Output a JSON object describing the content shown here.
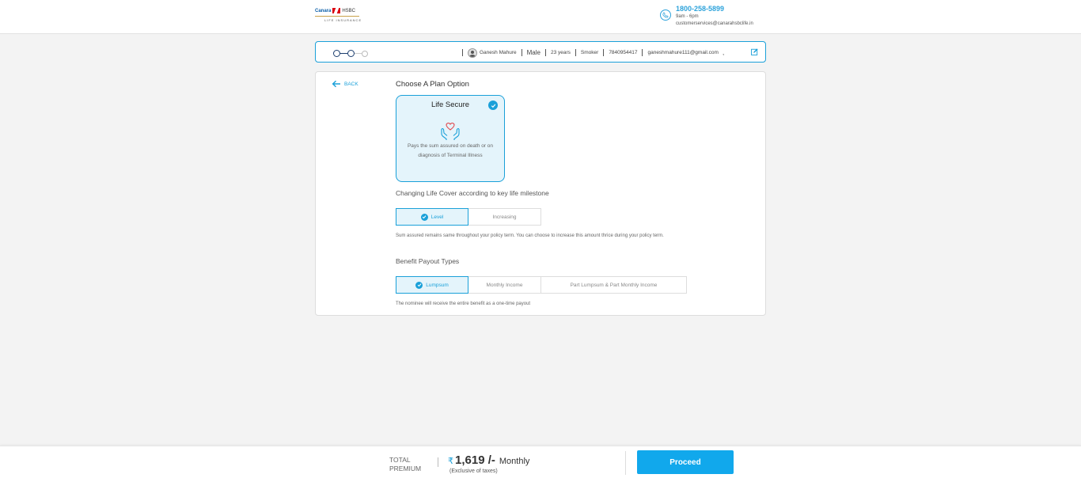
{
  "header": {
    "logo": {
      "brand_canara": "Canara",
      "brand_hsbc": "HSBC",
      "tagline": "LIFE INSURANCE"
    },
    "contact": {
      "phone": "1800-258-5899",
      "hours": "9am - 6pm",
      "email": "customerservices@canarahsbclife.in"
    }
  },
  "profile_bar": {
    "steps_total": 3,
    "steps_completed": 2,
    "name": "Ganesh Mahure",
    "gender": "Male",
    "age": "23 years",
    "smoker": "Smoker",
    "phone": "7840954417",
    "email": "ganeshmahure111@gmail.com",
    "trailing": ","
  },
  "main": {
    "back_label": "BACK",
    "section_title": "Choose A Plan Option",
    "plan": {
      "title": "Life Secure",
      "description": "Pays the sum assured on death or on diagnosis of Terminal Illness",
      "selected": true
    },
    "cover_title": "Changing Life Cover according to key life milestone",
    "cover_options": [
      "Level",
      "Increasing"
    ],
    "cover_selected": "Level",
    "cover_note": "Sum assured remains same throughout your policy term. You can choose to increase this amount thrice during your policy term.",
    "payout_title": "Benefit Payout Types",
    "payout_options": [
      "Lumpsum",
      "Monthly Income",
      "Part Lumpsum & Part Monthly Income"
    ],
    "payout_selected": "Lumpsum",
    "payout_note": "The nominee will receive the entire benefit as a one-time payout"
  },
  "footer": {
    "total_label_line1": "TOTAL",
    "total_label_line2": "PREMIUM",
    "currency_symbol": "₹",
    "amount": "1,619 /-",
    "period": "Monthly",
    "tax_note": "(Exclusive of taxes)",
    "proceed_label": "Proceed"
  },
  "colors": {
    "accent": "#1aa0d9",
    "selected_bg": "#e4f4fb",
    "proceed_bg": "#11a8ec",
    "page_bg": "#f3f3f3"
  }
}
